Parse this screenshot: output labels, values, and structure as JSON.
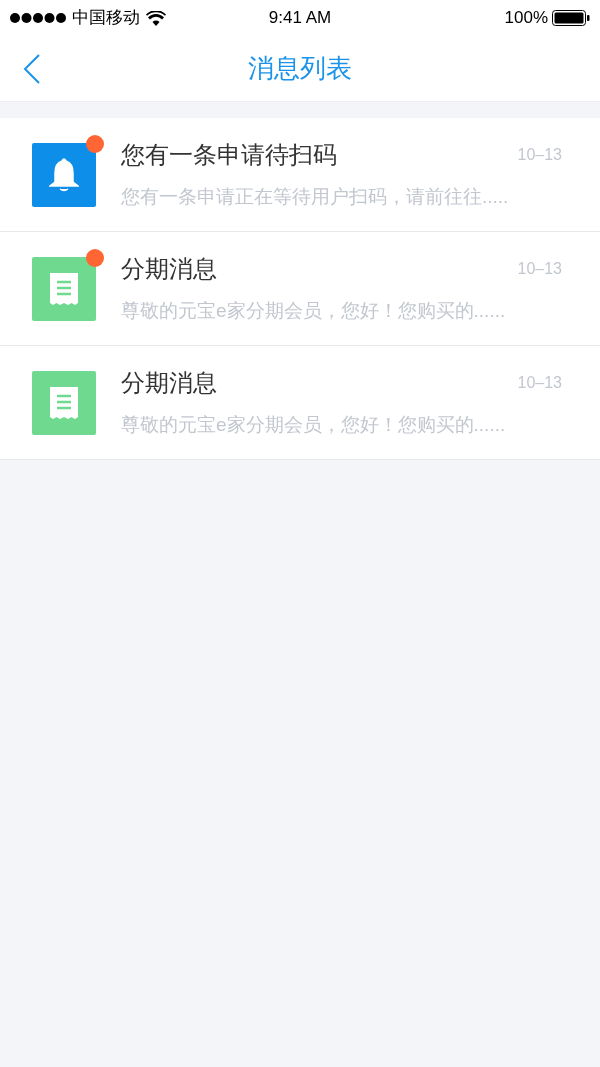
{
  "status_bar": {
    "carrier": "中国移动",
    "time": "9:41 AM",
    "battery": "100%"
  },
  "nav": {
    "title": "消息列表"
  },
  "messages": [
    {
      "kind": "bell",
      "unread": true,
      "title": "您有一条申请待扫码",
      "date": "10–13",
      "preview": "您有一条申请正在等待用户扫码，请前往往....."
    },
    {
      "kind": "receipt",
      "unread": true,
      "title": "分期消息",
      "date": "10–13",
      "preview": "尊敬的元宝e家分期会员，您好！您购买的......"
    },
    {
      "kind": "receipt",
      "unread": false,
      "title": "分期消息",
      "date": "10–13",
      "preview": "尊敬的元宝e家分期会员，您好！您购买的......"
    }
  ]
}
